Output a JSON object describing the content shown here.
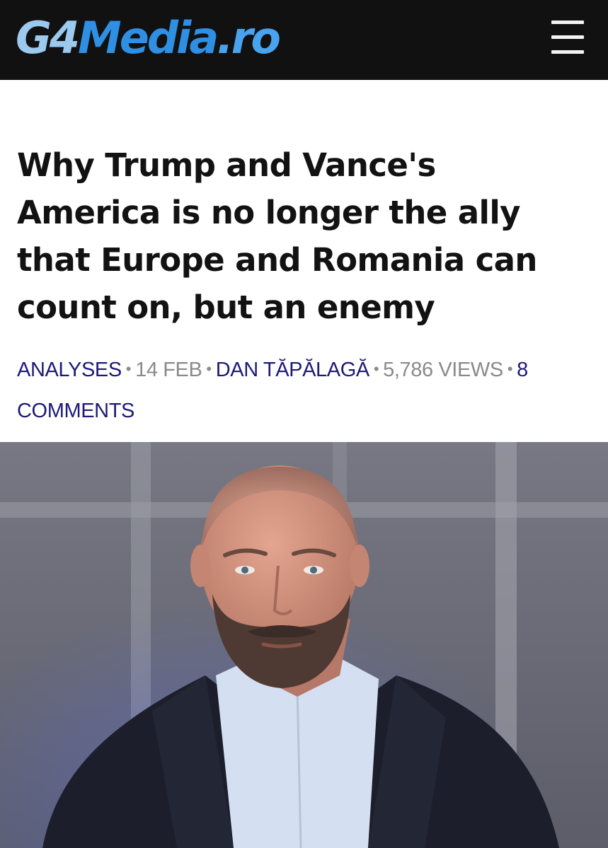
{
  "header": {
    "logo": {
      "part1": "G4",
      "part2": "Media",
      "part3": ".ro"
    },
    "menu_icon": "hamburger-menu-icon"
  },
  "article": {
    "title": "Why Trump and Vance's America is no longer the ally that Europe and Romania can count on, but an enemy",
    "meta": {
      "category": "ANALYSES",
      "date": "14 FEB",
      "author": "DAN TĂPĂLAGĂ",
      "views": "5,786 VIEWS",
      "comments": "8 COMMENTS",
      "separator": "•"
    },
    "photo": "author-portrait"
  },
  "colors": {
    "header_bg": "#111111",
    "logo_light": "#9cc9ee",
    "logo_blue": "#2f8fe3",
    "link": "#1e1a78",
    "muted": "#8a8a8a",
    "title": "#121212"
  }
}
